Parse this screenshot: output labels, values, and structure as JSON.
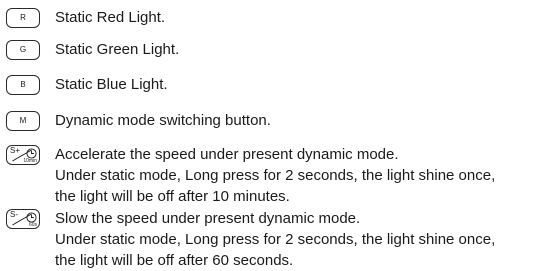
{
  "items": [
    {
      "key": "R",
      "lines": [
        "Static Red Light."
      ]
    },
    {
      "key": "G",
      "lines": [
        "Static Green Light."
      ]
    },
    {
      "key": "B",
      "lines": [
        "Static Blue Light."
      ]
    },
    {
      "key": "M",
      "lines": [
        "Dynamic mode switching button."
      ]
    },
    {
      "key_sign": "S+",
      "key_time": "10min",
      "key_icon": "clock-icon",
      "lines": [
        "Accelerate the speed under present dynamic mode.",
        "Under static mode, Long press for 2 seconds, the light shine once,",
        "the light will be off after 10 minutes."
      ]
    },
    {
      "key_sign": "S-",
      "key_time": "60s",
      "key_icon": "clock-icon",
      "lines": [
        "Slow the speed under present dynamic mode.",
        "Under static mode, Long press for 2 seconds, the light shine once,",
        "the light will be off after 60 seconds."
      ]
    }
  ]
}
